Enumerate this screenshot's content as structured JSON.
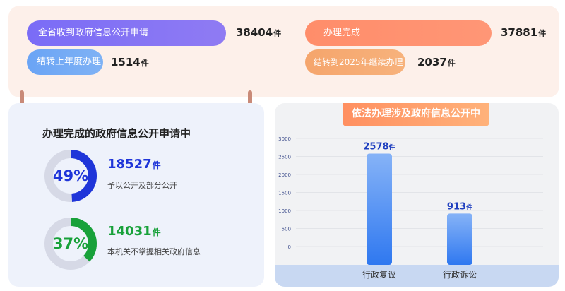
{
  "summary": {
    "received_label": "全省收到政府信息公开申请",
    "received_value": "38404",
    "completed_label": "办理完成",
    "completed_value": "37881",
    "carried_in_label": "结转上年度办理",
    "carried_in_value": "1514",
    "carried_out_label": "结转到2025年继续办理",
    "carried_out_value": "2037",
    "unit": "件"
  },
  "completed_panel": {
    "title": "办理完成的政府信息公开申请中",
    "items": [
      {
        "percent_label": "49%",
        "percent": 0.49,
        "value": "18527",
        "unit": "件",
        "label": "予以公开及部分公开",
        "color": "#1f35d9",
        "track": "#d6d9e6"
      },
      {
        "percent_label": "37%",
        "percent": 0.37,
        "value": "14031",
        "unit": "件",
        "label": "本机关不掌握相关政府信息",
        "color": "#18a13a",
        "track": "#d6d9e6"
      }
    ]
  },
  "chart_panel": {
    "banner": "依法办理涉及政府信息公开中"
  },
  "chart_data": {
    "type": "bar",
    "title": "依法办理涉及政府信息公开中",
    "categories": [
      "行政复议",
      "行政诉讼"
    ],
    "values": [
      2578,
      913
    ],
    "value_labels": [
      "2578",
      "913"
    ],
    "unit": "件",
    "ylim": [
      0,
      3000
    ],
    "yticks": [
      0,
      500,
      1000,
      1500,
      2000,
      2500,
      3000
    ],
    "grid": true,
    "bar_color_top": "#86b3f7",
    "bar_color_bottom": "#2f78f0",
    "label_color": "#1f3fbf"
  }
}
